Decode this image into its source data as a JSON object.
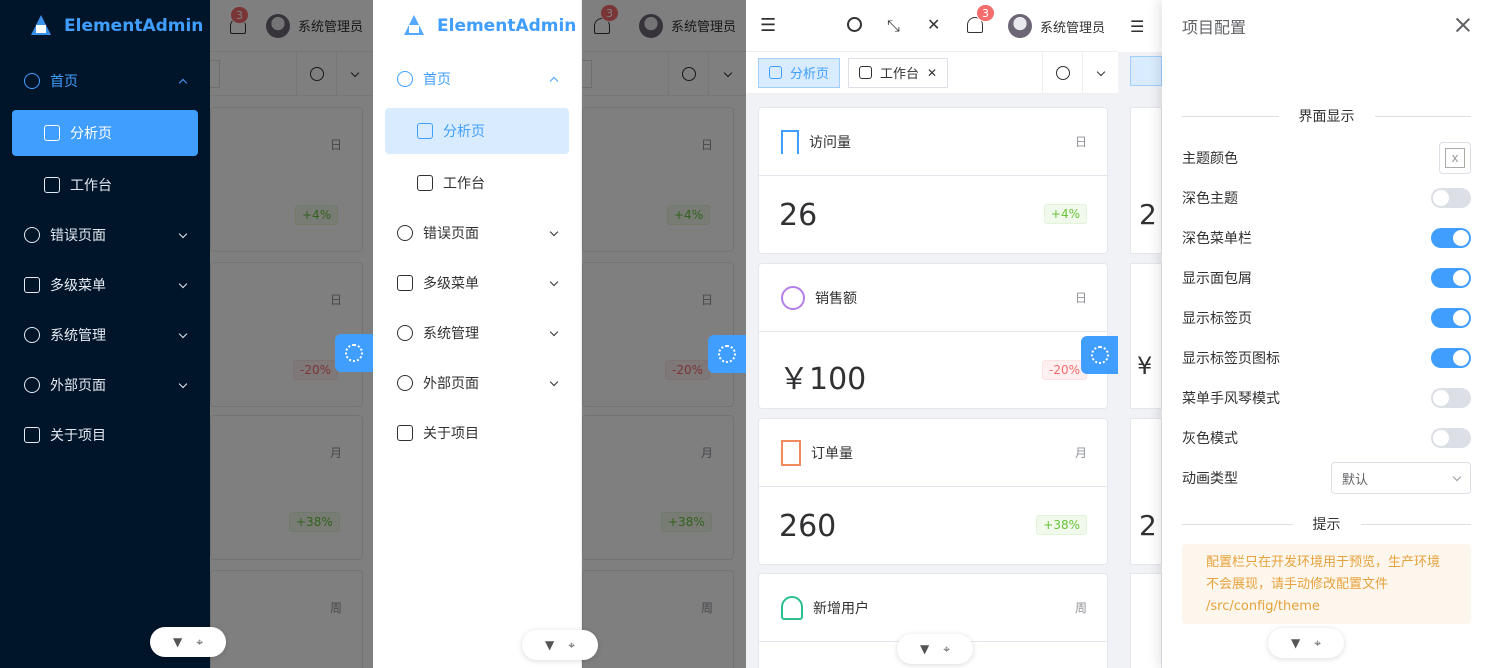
{
  "brand": {
    "name": "ElementAdmin",
    "color": "#409eff"
  },
  "header": {
    "badge_count": "3",
    "user_name": "系统管理员"
  },
  "menu": {
    "home": "首页",
    "analysis": "分析页",
    "workbench": "工作台",
    "error_page": "错误页面",
    "multi_menu": "多级菜单",
    "system": "系统管理",
    "external": "外部页面",
    "about": "关于项目"
  },
  "tabs": {
    "analysis": "分析页",
    "workbench": "工作台"
  },
  "cards": [
    {
      "title": "访问量",
      "period": "日",
      "value": "26",
      "change": "+4%",
      "trend": "up",
      "icon": "bookmark-icon",
      "icon_color": "#409eff"
    },
    {
      "title": "销售额",
      "period": "日",
      "value": "￥100",
      "change": "-20%",
      "trend": "down",
      "icon": "lifebuoy-icon",
      "icon_color": "#b37feb"
    },
    {
      "title": "订单量",
      "period": "月",
      "value": "260",
      "change": "+38%",
      "trend": "up",
      "icon": "document-icon",
      "icon_color": "#f08a5d"
    },
    {
      "title": "新增用户",
      "period": "周",
      "value": "",
      "change": "",
      "trend": "",
      "icon": "user-icon",
      "icon_color": "#2fbf8f"
    }
  ],
  "settings": {
    "title": "项目配置",
    "section_display": "界面显示",
    "theme_color": "主题颜色",
    "theme_color_value": "x",
    "dark_theme": "深色主题",
    "dark_menu": "深色菜单栏",
    "show_breadcrumb": "显示面包屑",
    "show_tabs": "显示标签页",
    "show_tab_icon": "显示标签页图标",
    "accordion_menu": "菜单手风琴模式",
    "gray_mode": "灰色模式",
    "animation_type": "动画类型",
    "animation_value": "默认",
    "section_tip": "提示",
    "tip_text_1": "配置栏只在开发环境用于预览，生产环境",
    "tip_text_2": "不会展现，请手动修改配置文件",
    "tip_text_3": "/src/config/theme",
    "toggles": {
      "dark_theme": false,
      "dark_menu": true,
      "show_breadcrumb": true,
      "show_tabs": true,
      "show_tab_icon": true,
      "accordion_menu": false,
      "gray_mode": false
    }
  },
  "colors": {
    "primary": "#409eff",
    "dark_sidebar": "#001529",
    "success": "#67c23a",
    "danger": "#f56c6c",
    "warning": "#e6a23c"
  }
}
